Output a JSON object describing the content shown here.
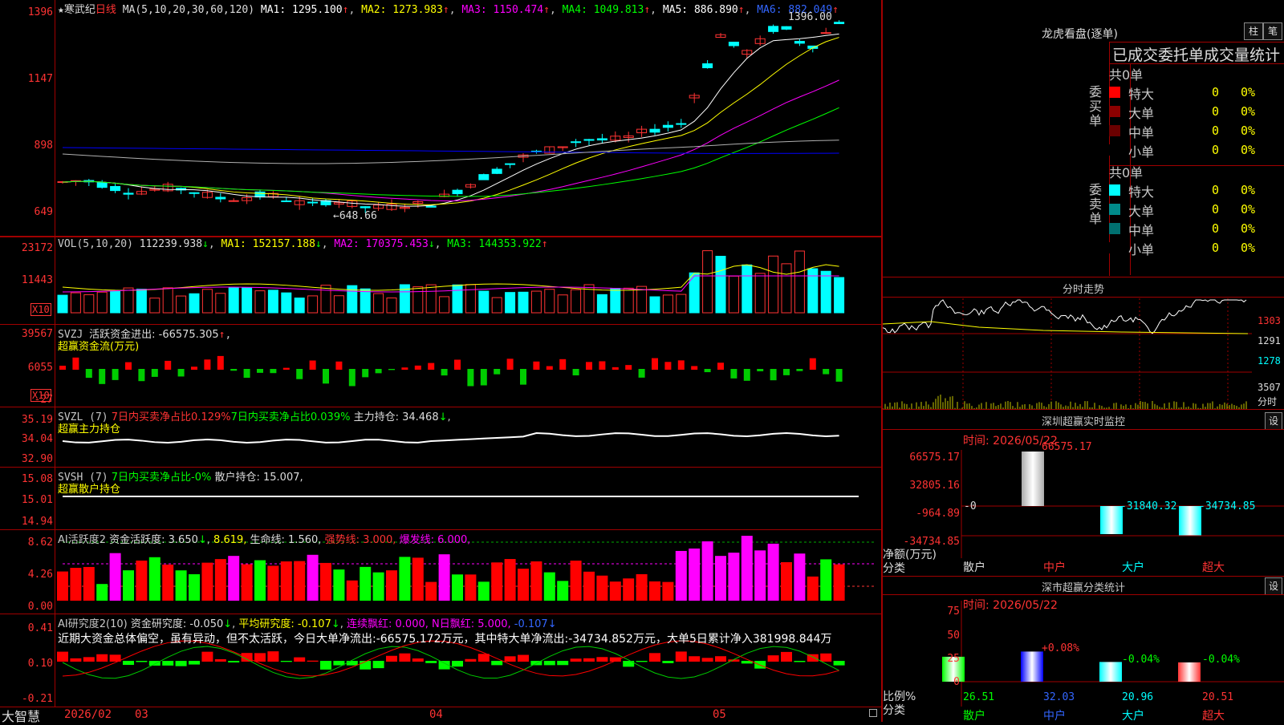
{
  "stock": {
    "star": "★",
    "name": "寒武纪",
    "period": "日线"
  },
  "kline": {
    "ma_label": "MA(5,10,20,30,60,120)",
    "ma1": "MA1: 1295.100",
    "ma2": "MA2: 1273.983",
    "ma3": "MA3: 1150.474",
    "ma4": "MA4: 1049.813",
    "ma5": "MA5: 886.890",
    "ma6": "MA6: 882.049",
    "y_ticks": [
      "1396",
      "1147",
      "898",
      "649"
    ],
    "high_label": "1396.00",
    "low_label": "648.66",
    "ma_colors": {
      "ma1": "#ffffff",
      "ma2": "#ffff00",
      "ma3": "#ff00ff",
      "ma4": "#00ff00",
      "ma5": "#0000ff",
      "ma6": "#b0b0b0"
    }
  },
  "vol": {
    "label": "VOL(5,10,20)",
    "value": "112239.938",
    "ma1": "MA1: 152157.188",
    "ma2": "MA2: 170375.453",
    "ma3": "MA3: 144353.922",
    "y_ticks": [
      "23172",
      "11443"
    ],
    "unit": "X10"
  },
  "svzj": {
    "label": "SVZJ",
    "title": "活跃资金进出: -66575.305",
    "sub": "超赢资金流(万元)",
    "y_ticks": [
      "39567",
      "6055",
      "-27"
    ],
    "unit": "X10"
  },
  "svzl": {
    "label": "SVZL (7)",
    "a": "7日内买卖净占比0.129%",
    "b": "7日内买卖净占比0.039%",
    "c": "主力持仓: 34.468",
    "sub": "超赢主力持仓",
    "y_ticks": [
      "35.19",
      "34.04",
      "32.90"
    ]
  },
  "svsh": {
    "label": "SVSH (7)",
    "a": "7日内买卖净占比-0%",
    "c": "散户持仓: 15.007,",
    "sub": "超赢散户持仓",
    "y_ticks": [
      "15.08",
      "15.01",
      "14.94"
    ]
  },
  "ai1": {
    "label": "AI活跃度2",
    "a": "资金活跃度: 3.650",
    "b": "8.619,",
    "c": "生命线: 1.560,",
    "d": "强势线: 3.000,",
    "e": "爆发线: 6.000,",
    "y_ticks": [
      "8.62",
      "4.26",
      "0.00"
    ]
  },
  "ai2": {
    "label": "AI研究度2(10)",
    "a": "资金研究度: -0.050",
    "b": "平均研究度: -0.107",
    "c": "连续飘红: 0.000,",
    "d": "N日飘红: 5.000,",
    "e": "-0.107",
    "comment": "近期大资金总体偏空，虽有异动，但不太活跃，今日大单净流出:-66575.172万元，其中特大单净流出:-34734.852万元，大单5日累计净入381998.844万",
    "y_ticks": [
      "0.41",
      "0.10",
      "-0.21"
    ]
  },
  "xaxis": {
    "brand": "大智慧",
    "labels": [
      "2026/02",
      "03",
      "04",
      "05"
    ]
  },
  "lhb": {
    "title": "龙虎看盘(逐单)",
    "btn_bar": "柱",
    "btn_pen": "笔",
    "header": "已成交委托单成交量统计",
    "buy": {
      "side": "委买单",
      "total": "共0单",
      "rows": [
        {
          "name": "特大",
          "v": "0",
          "p": "0%",
          "c": "#ff0000"
        },
        {
          "name": "大单",
          "v": "0",
          "p": "0%",
          "c": "#8b0000"
        },
        {
          "name": "中单",
          "v": "0",
          "p": "0%",
          "c": "#6a0000"
        },
        {
          "name": "小单",
          "v": "0",
          "p": "0%",
          "c": "#000000"
        }
      ]
    },
    "sell": {
      "side": "委卖单",
      "total": "共0单",
      "rows": [
        {
          "name": "特大",
          "v": "0",
          "p": "0%",
          "c": "#00ffff"
        },
        {
          "name": "大单",
          "v": "0",
          "p": "0%",
          "c": "#008b8b"
        },
        {
          "name": "中单",
          "v": "0",
          "p": "0%",
          "c": "#007070"
        },
        {
          "name": "小单",
          "v": "0",
          "p": "0%",
          "c": "#000000"
        }
      ]
    }
  },
  "intraday": {
    "title": "分时走势",
    "y_ticks": [
      "1303",
      "1291",
      "1278"
    ],
    "vol_tick": "3507",
    "vol_unit": "分时"
  },
  "monitor": {
    "title": "深圳超赢实时监控",
    "set": "设",
    "time": "时间: 2026/05/22",
    "y_ticks": [
      "66575.17",
      "32805.16",
      "-964.89",
      "-34734.85"
    ],
    "values": [
      "-0",
      "66575.17",
      "-31840.32",
      "-34734.85"
    ],
    "cats": [
      "散户",
      "中户",
      "大户",
      "超大"
    ],
    "axis_label": "净额(万元)",
    "axis_label2": "分类"
  },
  "classify": {
    "title": "深市超赢分类统计",
    "set": "设",
    "time": "时间: 2026/05/22",
    "y_ticks": [
      "75",
      "50",
      "25",
      "0"
    ],
    "values": [
      "26.51",
      "32.03",
      "20.96",
      "20.51"
    ],
    "changes": [
      "",
      "+0.08%",
      "-0.04%",
      "-0.04%"
    ],
    "cats": [
      "散户",
      "中户",
      "大户",
      "超大"
    ],
    "axis_label": "比例%",
    "axis_label2": "分类"
  }
}
